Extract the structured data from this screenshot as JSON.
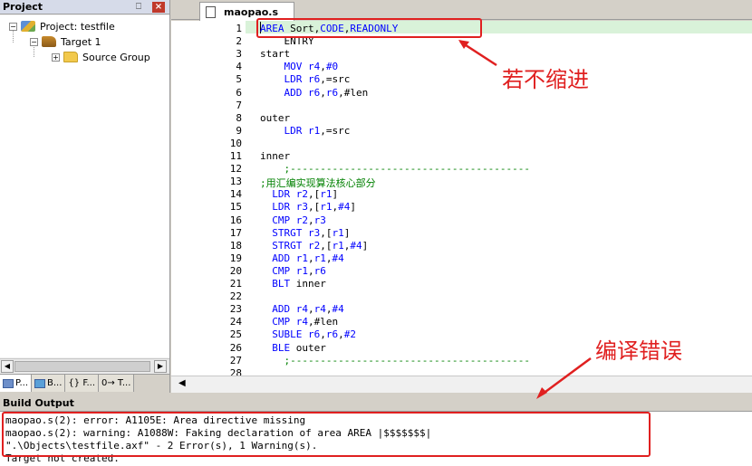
{
  "project_panel": {
    "title": "Project",
    "pin": "⎕",
    "close": "×",
    "tree": {
      "project": "Project: testfile",
      "target": "Target 1",
      "group": "Source Group"
    },
    "tabs": [
      "P...",
      "B...",
      "{} F...",
      "0→ T..."
    ]
  },
  "editor": {
    "tab_label": "maopao.s",
    "lines": [
      {
        "n": "1",
        "text": "AREA Sort,CODE,READONLY"
      },
      {
        "n": "2",
        "text": "    ENTRY"
      },
      {
        "n": "3",
        "text": "start"
      },
      {
        "n": "4",
        "text": "    MOV r4,#0"
      },
      {
        "n": "5",
        "text": "    LDR r6,=src"
      },
      {
        "n": "6",
        "text": "    ADD r6,r6,#len"
      },
      {
        "n": "7",
        "text": ""
      },
      {
        "n": "8",
        "text": "outer"
      },
      {
        "n": "9",
        "text": "    LDR r1,=src"
      },
      {
        "n": "10",
        "text": ""
      },
      {
        "n": "11",
        "text": "inner"
      },
      {
        "n": "12",
        "text": "    ;----------------------------------------"
      },
      {
        "n": "13",
        "text": ";用汇编实现算法核心部分"
      },
      {
        "n": "14",
        "text": "  LDR r2,[r1]"
      },
      {
        "n": "15",
        "text": "  LDR r3,[r1,#4]"
      },
      {
        "n": "16",
        "text": "  CMP r2,r3"
      },
      {
        "n": "17",
        "text": "  STRGT r3,[r1]"
      },
      {
        "n": "18",
        "text": "  STRGT r2,[r1,#4]"
      },
      {
        "n": "19",
        "text": "  ADD r1,r1,#4"
      },
      {
        "n": "20",
        "text": "  CMP r1,r6"
      },
      {
        "n": "21",
        "text": "  BLT inner"
      },
      {
        "n": "22",
        "text": ""
      },
      {
        "n": "23",
        "text": "  ADD r4,r4,#4"
      },
      {
        "n": "24",
        "text": "  CMP r4,#len"
      },
      {
        "n": "25",
        "text": "  SUBLE r6,r6,#2"
      },
      {
        "n": "26",
        "text": "  BLE outer"
      },
      {
        "n": "27",
        "text": "    ;----------------------------------------"
      },
      {
        "n": "28",
        "text": ""
      }
    ]
  },
  "build_output": {
    "title": "Build Output",
    "lines": [
      "maopao.s(2): error: A1105E: Area directive missing",
      "maopao.s(2): warning: A1088W: Faking declaration of area AREA |$$$$$$$|",
      "\".\\Objects\\testfile.axf\" - 2 Error(s), 1 Warning(s).",
      "Target not created."
    ]
  },
  "annotations": {
    "top": "若不缩进",
    "bottom": "编译错误",
    "color": "#e02020"
  }
}
